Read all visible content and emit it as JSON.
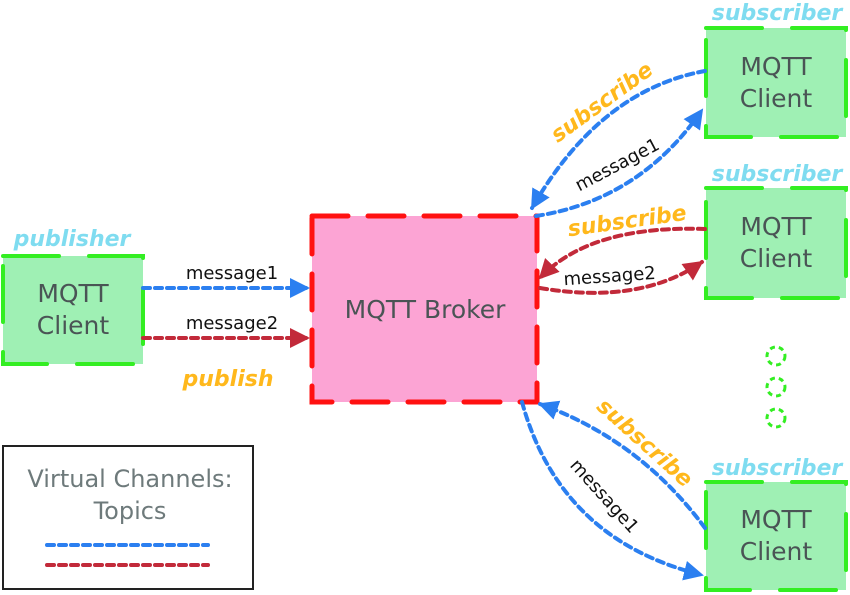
{
  "colors": {
    "client_fill": "#9ff0b4",
    "client_border": "#33ee22",
    "broker_fill": "#fca4d4",
    "broker_border": "#ff1111",
    "topic1": "#2b7ff0",
    "topic2": "#c22a3a",
    "role_label": "#7fdcf0",
    "action_label": "#ffb81c"
  },
  "broker": {
    "label": "MQTT Broker"
  },
  "publisher": {
    "role": "publisher",
    "line1": "MQTT",
    "line2": "Client",
    "action": "publish",
    "messages": [
      "message1",
      "message2"
    ]
  },
  "subscribers": [
    {
      "role": "subscriber",
      "line1": "MQTT",
      "line2": "Client",
      "action": "subscribe",
      "message": "message1",
      "topic": "topic1"
    },
    {
      "role": "subscriber",
      "line1": "MQTT",
      "line2": "Client",
      "action": "subscribe",
      "message": "message2",
      "topic": "topic2"
    },
    {
      "role": "subscriber",
      "line1": "MQTT",
      "line2": "Client",
      "action": "subscribe",
      "message": "message1",
      "topic": "topic1"
    }
  ],
  "ellipsis": {
    "count": 3,
    "meaning": "more subscribers"
  },
  "legend": {
    "line1": "Virtual Channels:",
    "line2": "Topics",
    "entries": [
      "topic1",
      "topic2"
    ]
  }
}
